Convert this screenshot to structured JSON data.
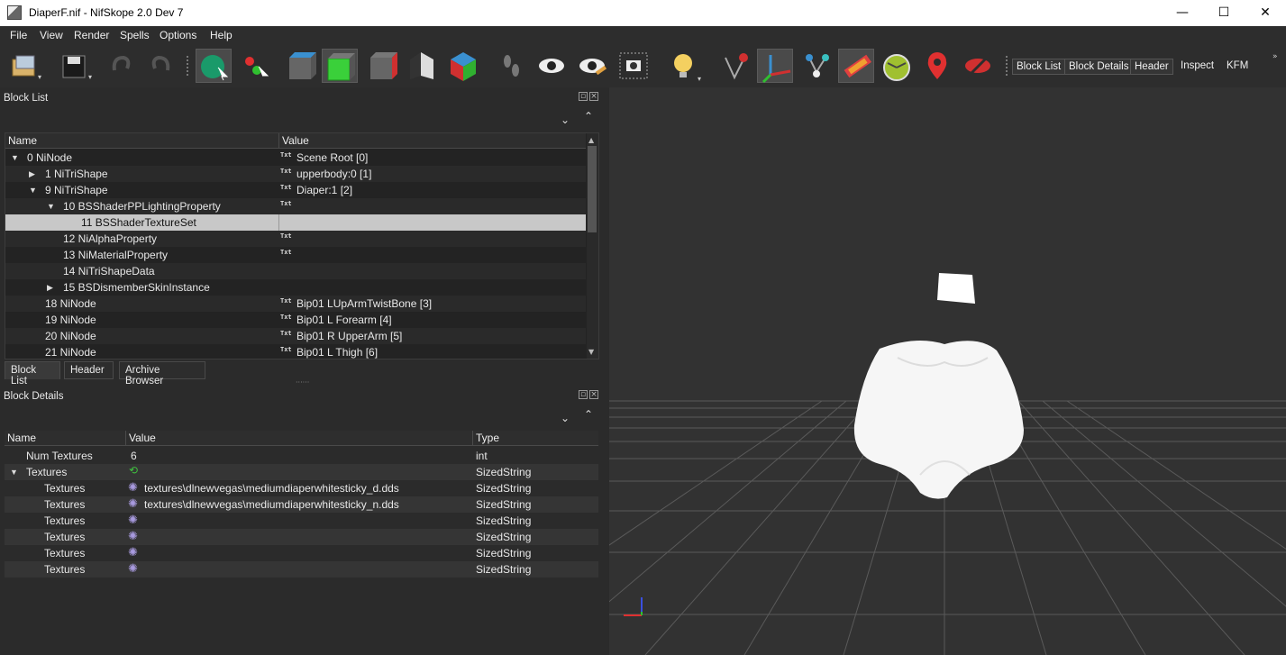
{
  "window": {
    "title": "DiaperF.nif - NifSkope 2.0 Dev 7",
    "min_label": "—",
    "max_label": "☐",
    "close_label": "✕"
  },
  "menu": [
    "File",
    "View",
    "Render",
    "Spells",
    "Options",
    "Help"
  ],
  "toolbar": {
    "views": [
      "Block List",
      "Block Details",
      "Header",
      "Inspect",
      "KFM"
    ]
  },
  "block_list": {
    "title": "Block List",
    "columns": [
      "Name",
      "Value"
    ],
    "rows": [
      {
        "name": "0 NiNode",
        "value": "Scene Root [0]",
        "expander": "▼",
        "txt": true
      },
      {
        "name": "1 NiTriShape",
        "value": "upperbody:0 [1]",
        "expander": "▶",
        "txt": true
      },
      {
        "name": "9 NiTriShape",
        "value": "Diaper:1 [2]",
        "expander": "▼",
        "txt": true
      },
      {
        "name": "10 BSShaderPPLightingProperty",
        "value": "",
        "expander": "▼",
        "txt": true
      },
      {
        "name": "11 BSShaderTextureSet",
        "value": "",
        "expander": "",
        "txt": false
      },
      {
        "name": "12 NiAlphaProperty",
        "value": "",
        "expander": "",
        "txt": true
      },
      {
        "name": "13 NiMaterialProperty",
        "value": "",
        "expander": "",
        "txt": true
      },
      {
        "name": "14 NiTriShapeData",
        "value": "",
        "expander": "",
        "txt": false
      },
      {
        "name": "15 BSDismemberSkinInstance",
        "value": "",
        "expander": "▶",
        "txt": false
      },
      {
        "name": "18 NiNode",
        "value": "Bip01 LUpArmTwistBone [3]",
        "expander": "",
        "txt": true
      },
      {
        "name": "19 NiNode",
        "value": "Bip01 L Forearm [4]",
        "expander": "",
        "txt": true
      },
      {
        "name": "20 NiNode",
        "value": "Bip01 R UpperArm [5]",
        "expander": "",
        "txt": true
      },
      {
        "name": "21 NiNode",
        "value": "Bip01 L Thigh [6]",
        "expander": "",
        "txt": true
      }
    ],
    "txt_label": "Txt",
    "tabs": [
      "Block List",
      "Header",
      "Archive Browser"
    ]
  },
  "block_details": {
    "title": "Block Details",
    "columns": [
      "Name",
      "Value",
      "Type"
    ],
    "rows": [
      {
        "name": "Num Textures",
        "value": "6",
        "type": "int"
      },
      {
        "name": "Textures",
        "value": "",
        "type": "SizedString"
      },
      {
        "name": "Textures",
        "value": "textures\\dlnewvegas\\mediumdiaperwhitesticky_d.dds",
        "type": "SizedString"
      },
      {
        "name": "Textures",
        "value": "textures\\dlnewvegas\\mediumdiaperwhitesticky_n.dds",
        "type": "SizedString"
      },
      {
        "name": "Textures",
        "value": "",
        "type": "SizedString"
      },
      {
        "name": "Textures",
        "value": "",
        "type": "SizedString"
      },
      {
        "name": "Textures",
        "value": "",
        "type": "SizedString"
      },
      {
        "name": "Textures",
        "value": "",
        "type": "SizedString"
      }
    ]
  },
  "colors": {
    "background": "#2b2b2b",
    "viewport": "#323232",
    "selection": "#c8c8c8"
  }
}
